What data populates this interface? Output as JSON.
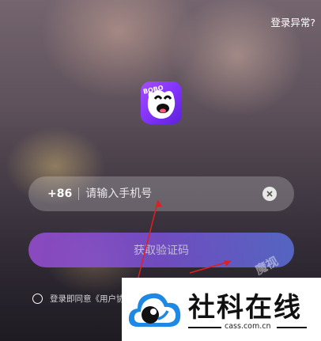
{
  "header": {
    "login_issue_link": "登录异常?"
  },
  "app_icon": {
    "text": "BOBO",
    "name": "bobo-app-icon"
  },
  "phone": {
    "country_code": "+86",
    "placeholder": "请输入手机号",
    "value": ""
  },
  "actions": {
    "get_code_label": "获取验证码"
  },
  "agreement": {
    "text": "登录即同意《用户协"
  },
  "watermark": {
    "text": "魔视",
    "site_name": "社科在线",
    "site_domain": "cass.com.cn"
  },
  "colors": {
    "accent_start": "#9a4fd6",
    "accent_end": "#5a6fd8",
    "icon_purple": "#7b2ff7",
    "arrow_red": "#e02020",
    "stamp_blue": "#1e88e5"
  }
}
